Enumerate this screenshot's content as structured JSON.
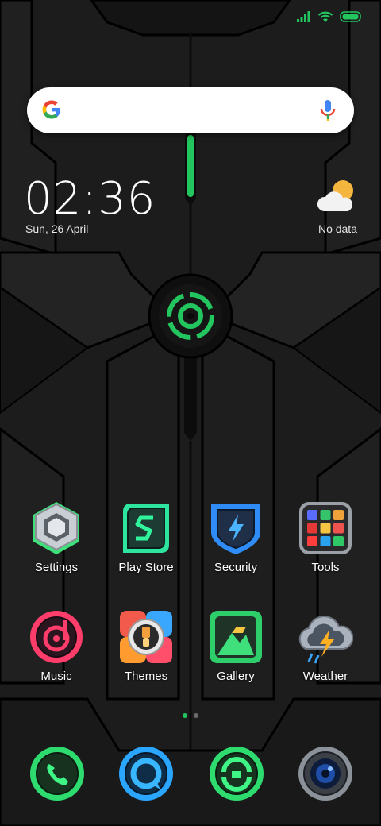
{
  "status_bar": {
    "signal_icon": "signal-icon",
    "wifi_icon": "wifi-icon",
    "battery_icon": "battery-icon",
    "accent": "#22c55e"
  },
  "search": {
    "placeholder": "",
    "logo_icon": "google-g-icon",
    "mic_icon": "mic-icon"
  },
  "clock": {
    "time": "02:36",
    "date": "Sun, 26 April"
  },
  "weather_widget": {
    "icon": "partly-cloudy-icon",
    "text": "No data"
  },
  "apps": [
    {
      "label": "Settings",
      "icon": "settings-hex-icon"
    },
    {
      "label": "Play Store",
      "icon": "play-store-icon"
    },
    {
      "label": "Security",
      "icon": "security-shield-icon"
    },
    {
      "label": "Tools",
      "icon": "tools-folder-icon"
    },
    {
      "label": "Music",
      "icon": "music-icon"
    },
    {
      "label": "Themes",
      "icon": "themes-brush-icon"
    },
    {
      "label": "Gallery",
      "icon": "gallery-mountain-icon"
    },
    {
      "label": "Weather",
      "icon": "weather-storm-icon"
    }
  ],
  "page_indicator": {
    "pages": 2,
    "current": 1
  },
  "dock": [
    {
      "icon": "phone-icon"
    },
    {
      "icon": "messages-icon"
    },
    {
      "icon": "browser-icon"
    },
    {
      "icon": "camera-icon"
    }
  ]
}
